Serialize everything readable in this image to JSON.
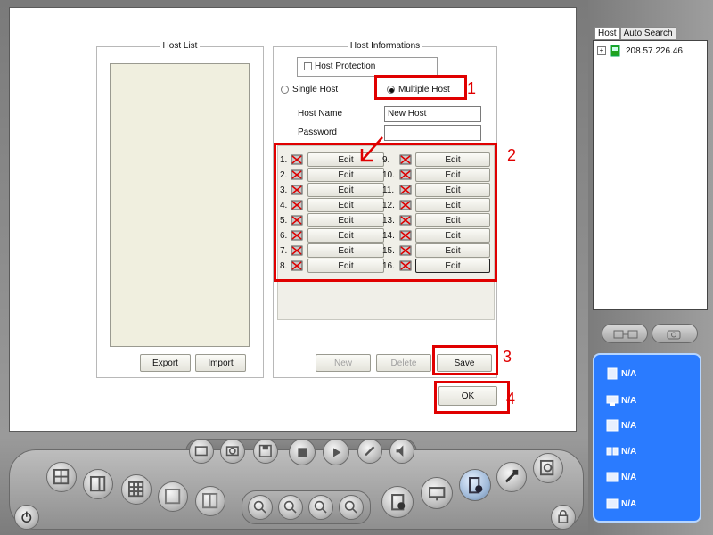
{
  "host_list": {
    "title": "Host List",
    "export_label": "Export",
    "import_label": "Import"
  },
  "host_info": {
    "title": "Host Informations",
    "host_protection_label": "Host Protection",
    "single_host_label": "Single Host",
    "multiple_host_label": "Multiple Host",
    "host_name_label": "Host Name",
    "host_name_value": "New Host",
    "password_label": "Password",
    "password_value": "",
    "channels_left": [
      {
        "num": "1.",
        "label": "Edit"
      },
      {
        "num": "2.",
        "label": "Edit"
      },
      {
        "num": "3.",
        "label": "Edit"
      },
      {
        "num": "4.",
        "label": "Edit"
      },
      {
        "num": "5.",
        "label": "Edit"
      },
      {
        "num": "6.",
        "label": "Edit"
      },
      {
        "num": "7.",
        "label": "Edit"
      },
      {
        "num": "8.",
        "label": "Edit"
      }
    ],
    "channels_right": [
      {
        "num": "9.",
        "label": "Edit"
      },
      {
        "num": "10.",
        "label": "Edit"
      },
      {
        "num": "11.",
        "label": "Edit"
      },
      {
        "num": "12.",
        "label": "Edit"
      },
      {
        "num": "13.",
        "label": "Edit"
      },
      {
        "num": "14.",
        "label": "Edit"
      },
      {
        "num": "15.",
        "label": "Edit"
      },
      {
        "num": "16.",
        "label": "Edit"
      }
    ],
    "new_label": "New",
    "delete_label": "Delete",
    "save_label": "Save",
    "ok_label": "OK"
  },
  "annotations": {
    "step1": "1",
    "step2": "2",
    "step3": "3",
    "step4": "4",
    "color": "#e00000"
  },
  "right_panel": {
    "tab_host": "Host",
    "tab_auto_search": "Auto Search",
    "tree_item": "208.57.226.46",
    "status": [
      "N/A",
      "N/A",
      "N/A",
      "N/A",
      "N/A",
      "N/A"
    ]
  },
  "icons": {
    "channel_camera": "camera-disconnected-icon",
    "toolbar": [
      "single-view-icon",
      "quad-view-icon",
      "nine-view-icon",
      "sixteen-view-icon",
      "record-icon",
      "playback-icon",
      "stop-icon",
      "play-icon",
      "audio-icon",
      "zoom-in-icon",
      "zoom-out-icon",
      "info-icon",
      "network-icon",
      "add-host-icon",
      "tools-icon",
      "search-icon",
      "power-icon",
      "lock-icon"
    ]
  }
}
